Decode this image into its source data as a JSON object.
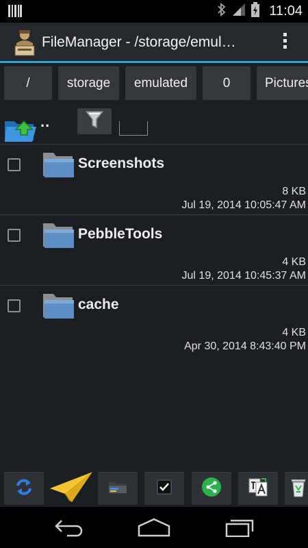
{
  "status_bar": {
    "time": "11:04",
    "icons": [
      "barcode-icon",
      "bluetooth-icon",
      "signal-icon",
      "battery-charging-icon"
    ]
  },
  "action_bar": {
    "title": "FileManager - /storage/emul…",
    "app_icon": "archive-man-icon",
    "overflow_icon": "overflow-menu-icon",
    "accent_color": "#2fa7d9"
  },
  "breadcrumbs": [
    "/",
    "storage",
    "emulated",
    "0",
    "Pictures"
  ],
  "toolbar": {
    "up_label": "..",
    "up_icon": "folder-up-icon",
    "filter_icon": "filter-icon",
    "filter_value": ""
  },
  "files": [
    {
      "name": "Screenshots",
      "size": "8 KB",
      "date": "Jul 19, 2014 10:05:47 AM"
    },
    {
      "name": "PebbleTools",
      "size": "4 KB",
      "date": "Jul 19, 2014 10:45:37 AM"
    },
    {
      "name": "cache",
      "size": "4 KB",
      "date": "Apr 30, 2014 8:43:40 PM"
    }
  ],
  "bottom_tools": [
    "refresh-icon",
    "paper-plane-icon",
    "folder-move-icon",
    "checkbox-select-icon",
    "share-icon",
    "translate-icon",
    "recycle-bin-icon"
  ],
  "nav_bar": [
    "back-icon",
    "home-icon",
    "recents-icon"
  ]
}
